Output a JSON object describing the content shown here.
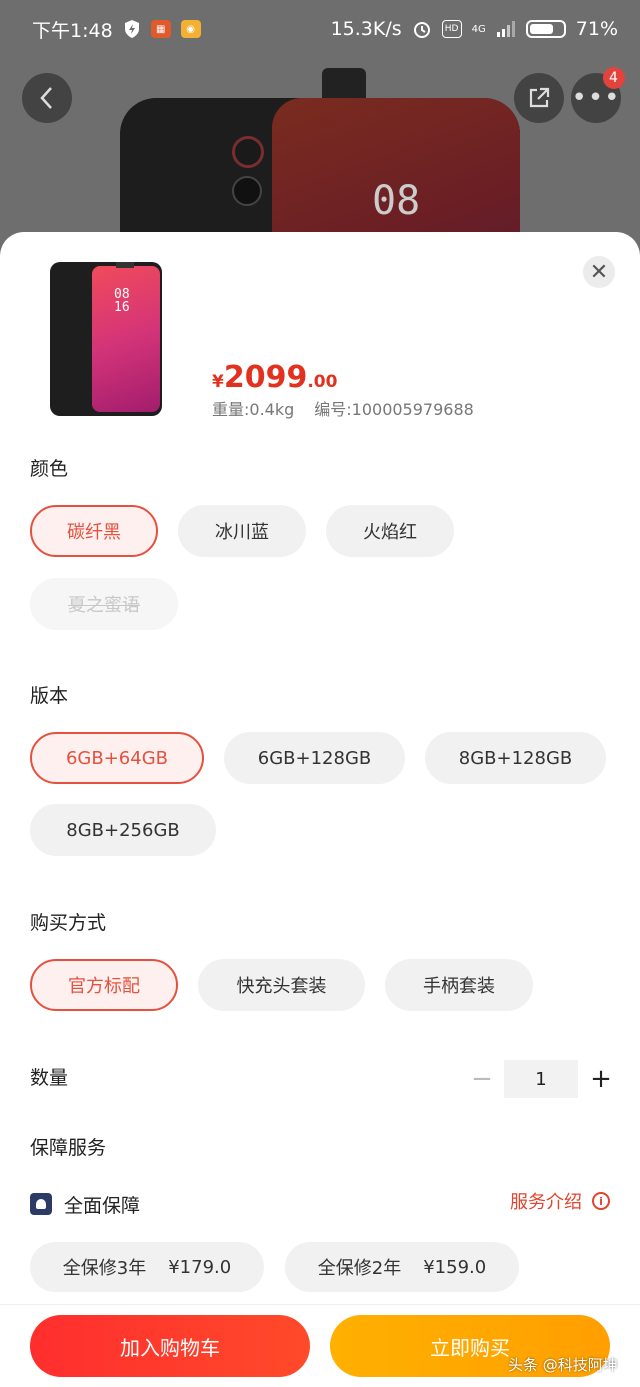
{
  "status_bar": {
    "time": "下午1:48",
    "net_speed": "15.3K/s",
    "network": "4G",
    "battery_percent": "71%",
    "battery_level": 0.71
  },
  "header": {
    "more_badge_count": "4",
    "phone_screen_time": "08"
  },
  "product": {
    "thumb_time": "08\n16",
    "price_symbol": "¥",
    "price_int": "2099",
    "price_dec": ".00",
    "weight": "重量:0.4kg",
    "sku": "编号:100005979688"
  },
  "color_section": {
    "title": "颜色",
    "options": [
      "碳纤黑",
      "冰川蓝",
      "火焰红",
      "夏之蜜语"
    ]
  },
  "version_section": {
    "title": "版本",
    "options": [
      "6GB+64GB",
      "6GB+128GB",
      "8GB+128GB",
      "8GB+256GB"
    ]
  },
  "purchase_section": {
    "title": "购买方式",
    "options": [
      "官方标配",
      "快充头套装",
      "手柄套装"
    ]
  },
  "quantity": {
    "title": "数量",
    "value": "1",
    "minus": "−",
    "plus": "+"
  },
  "service": {
    "title": "保障服务",
    "item_label": "全面保障",
    "intro_link": "服务介绍",
    "options": [
      {
        "name": "全保修3年",
        "price": "¥179.0"
      },
      {
        "name": "全保修2年",
        "price": "¥159.0"
      }
    ]
  },
  "actions": {
    "add_to_cart": "加入购物车",
    "buy_now": "立即购买"
  },
  "watermark": "头条 @科技阿坤",
  "colors": {
    "accent_red": "#e5513f",
    "buy_orange": "#ffa800"
  }
}
